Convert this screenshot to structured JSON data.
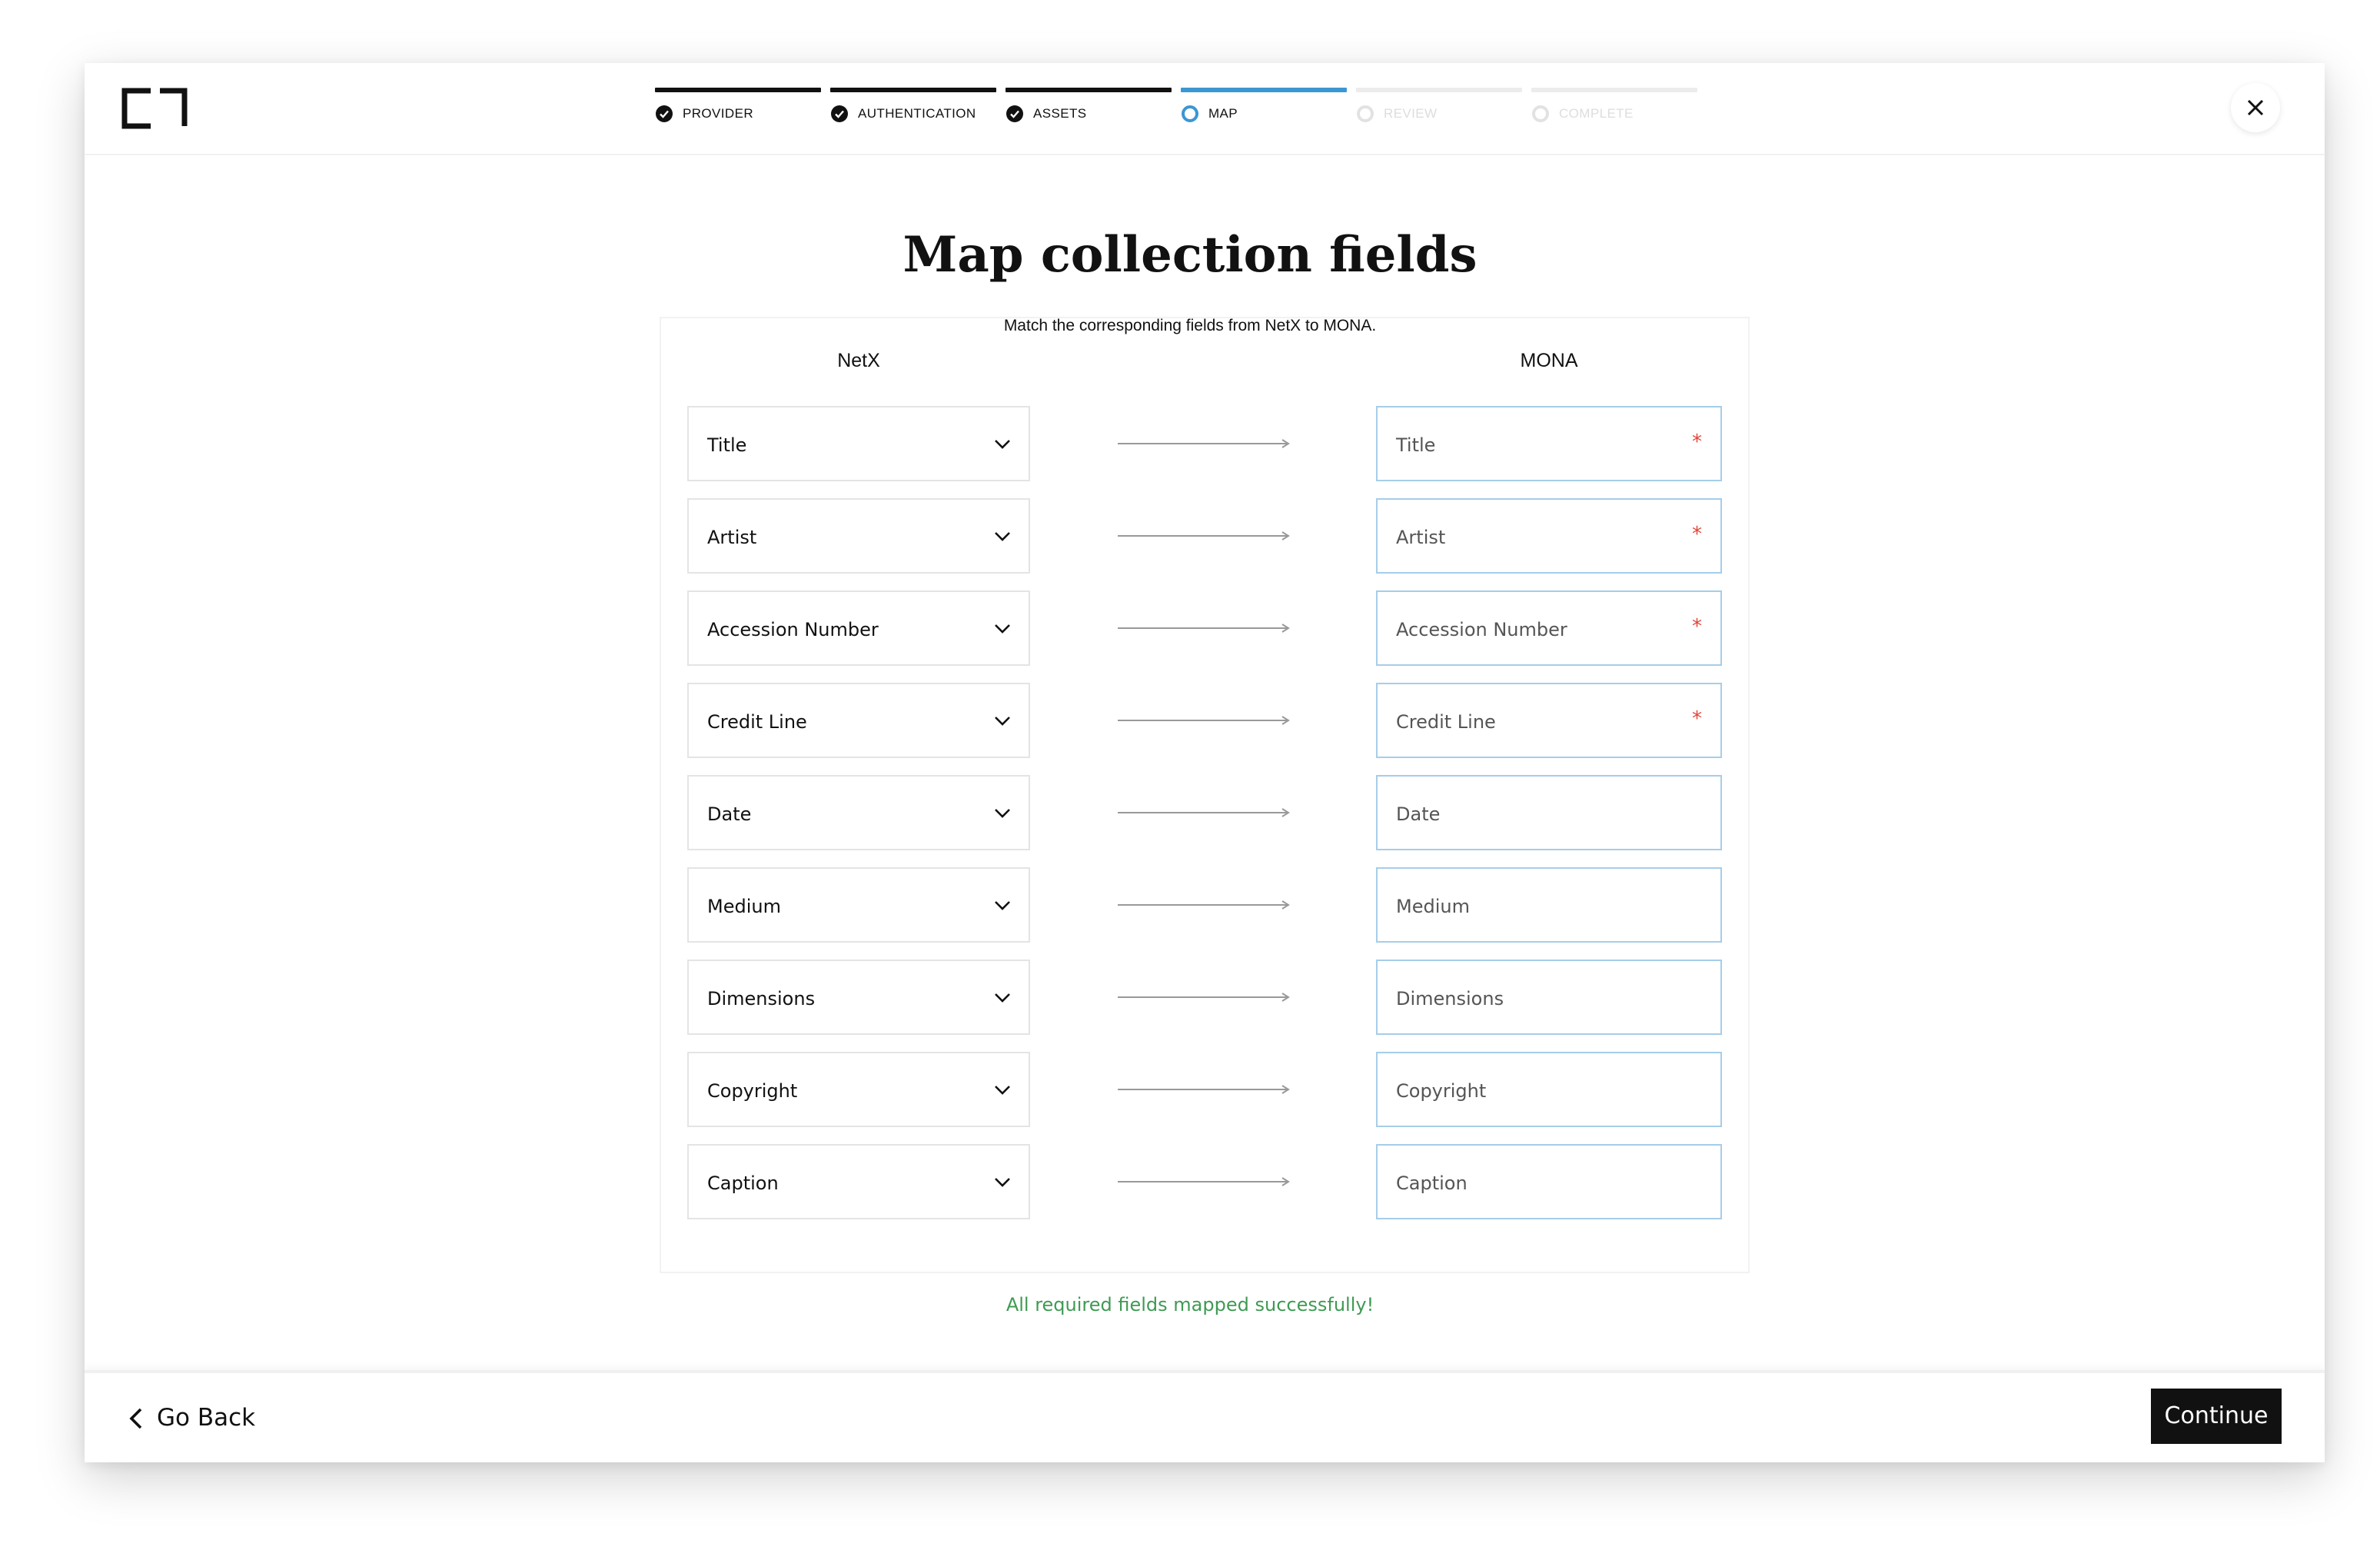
{
  "header": {
    "steps": [
      {
        "label": "PROVIDER",
        "state": "done"
      },
      {
        "label": "AUTHENTICATION",
        "state": "done"
      },
      {
        "label": "ASSETS",
        "state": "done"
      },
      {
        "label": "MAP",
        "state": "active"
      },
      {
        "label": "REVIEW",
        "state": "pending"
      },
      {
        "label": "COMPLETE",
        "state": "pending"
      }
    ],
    "close_icon": "close-icon",
    "logo_icon": "bracket-logo-icon"
  },
  "main": {
    "title": "Map collection fields",
    "subtitle": "Match the corresponding fields from NetX to MONA.",
    "source_column_label": "NetX",
    "target_column_label": "MONA",
    "rows": [
      {
        "source": "Title",
        "target": "Title",
        "required": true
      },
      {
        "source": "Artist",
        "target": "Artist",
        "required": true
      },
      {
        "source": "Accession Number",
        "target": "Accession Number",
        "required": true
      },
      {
        "source": "Credit Line",
        "target": "Credit Line",
        "required": true
      },
      {
        "source": "Date",
        "target": "Date",
        "required": false
      },
      {
        "source": "Medium",
        "target": "Medium",
        "required": false
      },
      {
        "source": "Dimensions",
        "target": "Dimensions",
        "required": false
      },
      {
        "source": "Copyright",
        "target": "Copyright",
        "required": false
      },
      {
        "source": "Caption",
        "target": "Caption",
        "required": false
      }
    ],
    "required_marker": "*",
    "success_message": "All required fields mapped successfully!"
  },
  "footer": {
    "back_label": "Go Back",
    "continue_label": "Continue"
  },
  "colors": {
    "accent": "#3b97d3",
    "success": "#3f9a53",
    "required": "#e2453a",
    "primary_button": "#111111"
  }
}
